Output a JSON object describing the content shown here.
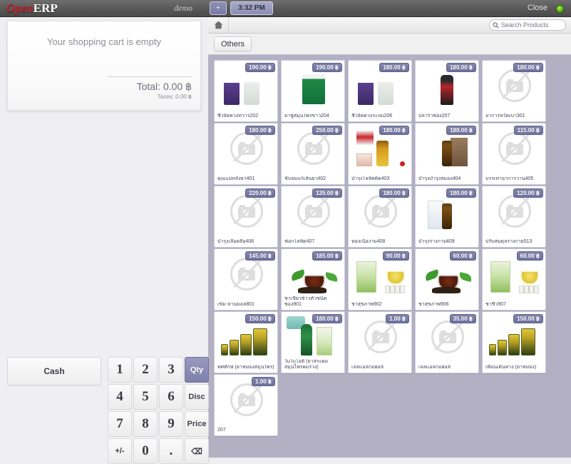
{
  "topbar": {
    "logo_open": "Open",
    "logo_erp": "ERP",
    "demo": "demo",
    "plus_label": "+",
    "time_tab": "3:32 PM",
    "close_label": "Close",
    "status_color": "#63c415"
  },
  "cart": {
    "empty_message": "Your shopping cart is empty",
    "total_label": "Total: 0.00 ฿",
    "taxes_label": "Taxes: 0.00 ฿"
  },
  "numpad": {
    "cash_label": "Cash",
    "keys": [
      "1",
      "2",
      "3",
      "4",
      "5",
      "6",
      "7",
      "8",
      "9",
      "+/-",
      "0",
      "."
    ],
    "backspace": "⌫",
    "modes": [
      {
        "label": "Qty",
        "active": true
      },
      {
        "label": "Disc",
        "active": false
      },
      {
        "label": "Price",
        "active": false
      }
    ]
  },
  "products_header": {
    "home_icon": "home-icon",
    "search_placeholder": "Search Products",
    "search_icon": "search-icon",
    "category_label": "Others"
  },
  "products": [
    {
      "name": "ชีวจิตดวงทวาร202",
      "price": "190.00 ฿",
      "image": "jar-purple"
    },
    {
      "name": "ยาชูสมุนไพรขาว204",
      "price": "190.00 ฿",
      "image": "jar-green"
    },
    {
      "name": "ชีวจิตดวงระบบ206",
      "price": "180.00 ฿",
      "image": "jar-purple"
    },
    {
      "name": "ปลาร้าซอง207",
      "price": "180.00 ฿",
      "image": "bottle-red"
    },
    {
      "name": "อาการหวัดเบา301",
      "price": "180.00 ฿",
      "image": "none"
    },
    {
      "name": "คุณแม่หลังยา401",
      "price": "180.00 ฿",
      "image": "none"
    },
    {
      "name": "ขับลมแก้เส้นยา402",
      "price": "250.00 ฿",
      "image": "none"
    },
    {
      "name": "บำรุงโลหิตติด403",
      "price": "180.00 ฿",
      "image": "pkg-red-amber"
    },
    {
      "name": "บำรุงบำรุงสมอง404",
      "price": "180.00 ฿",
      "image": "vial-brown-box"
    },
    {
      "name": "บรรเทาอาการวาน405",
      "price": "115.00 ฿",
      "image": "none"
    },
    {
      "name": "บำรุงเลือดสื่อ406",
      "price": "220.00 ฿",
      "image": "none"
    },
    {
      "name": "ฟอกโลหิต407",
      "price": "135.00 ฿",
      "image": "none"
    },
    {
      "name": "ทองเนื้องาม408",
      "price": "180.00 ฿",
      "image": "none"
    },
    {
      "name": "บำรุงร่างกาย409",
      "price": "180.00 ฿",
      "image": "box-vial-white"
    },
    {
      "name": "ปรับสมดุลร่างกาย513",
      "price": "120.00 ฿",
      "image": "none"
    },
    {
      "name": "เข้ม-ลานมอล801",
      "price": "145.00 ฿",
      "image": "none"
    },
    {
      "name": "ชาเขียวข้าวคั่วชนิดซอง901",
      "price": "185.00 ฿",
      "image": "tea-cup-leaves"
    },
    {
      "name": "ชาสุขภาพ902",
      "price": "90.00 ฿",
      "image": "tea-pack-bags"
    },
    {
      "name": "ชาสุขภาพ906",
      "price": "60.00 ฿",
      "image": "tea-cup-leaves"
    },
    {
      "name": "ชาชีว907",
      "price": "60.00 ฿",
      "image": "tea-pack-bags"
    },
    {
      "name": "ทศทักษ์ (ยาหม่องสมุนไพร)",
      "price": "150.00 ฿",
      "image": "balm-jars"
    },
    {
      "name": "ใบไบโอติ (ยาสระผมสมุนไพรผมร่วง)",
      "price": "180.00 ฿",
      "image": "shampoo-carton"
    },
    {
      "name": "เจลแอลกอฮอล์",
      "price": "1.00 ฿",
      "image": "none"
    },
    {
      "name": "เจลแอลกอฮอล์",
      "price": "35.00 ฿",
      "image": "none"
    },
    {
      "name": "เพื่อนเดินทาง (ยาหม่อง)",
      "price": "150.00 ฿",
      "image": "balm-jars"
    },
    {
      "name": "207",
      "price": "1.00 ฿",
      "image": "none"
    }
  ]
}
